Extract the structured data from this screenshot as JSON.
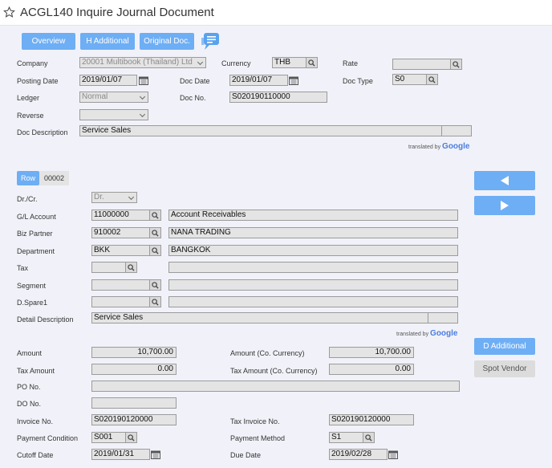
{
  "title": "ACGL140 Inquire Journal Document",
  "toolbar": {
    "overview": "Overview",
    "h_additional": "H Additional",
    "original_doc": "Original Doc."
  },
  "header": {
    "company_label": "Company",
    "company_value": "20001 Multibook (Thailand) Ltd",
    "currency_label": "Currency",
    "currency_value": "THB",
    "rate_label": "Rate",
    "rate_value": "",
    "posting_date_label": "Posting Date",
    "posting_date_value": "2019/01/07",
    "doc_date_label": "Doc Date",
    "doc_date_value": "2019/01/07",
    "doc_type_label": "Doc Type",
    "doc_type_value": "S0",
    "ledger_label": "Ledger",
    "ledger_value": "Normal",
    "doc_no_label": "Doc No.",
    "doc_no_value": "S020190110000",
    "reverse_label": "Reverse",
    "reverse_value": "",
    "doc_desc_label": "Doc Description",
    "doc_desc_value": "Service Sales"
  },
  "translated": {
    "prefix": "translated by",
    "brand": "Google"
  },
  "row": {
    "label": "Row",
    "value": "00002"
  },
  "detail": {
    "drcr_label": "Dr./Cr.",
    "drcr_value": "Dr.",
    "gl_label": "G/L Account",
    "gl_code": "11000000",
    "gl_name": "Account Receivables",
    "bp_label": "Biz Partner",
    "bp_code": "910002",
    "bp_name": "NANA TRADING",
    "dept_label": "Department",
    "dept_code": "BKK",
    "dept_name": "BANGKOK",
    "tax_label": "Tax",
    "segment_label": "Segment",
    "dspare_label": "D.Spare1",
    "detail_desc_label": "Detail Description",
    "detail_desc_value": "Service Sales"
  },
  "amounts": {
    "amount_label": "Amount",
    "amount_value": "10,700.00",
    "amount_cc_label": "Amount (Co. Currency)",
    "amount_cc_value": "10,700.00",
    "tax_amount_label": "Tax Amount",
    "tax_amount_value": "0.00",
    "tax_amount_cc_label": "Tax Amount (Co. Currency)",
    "tax_amount_cc_value": "0.00",
    "po_label": "PO No.",
    "do_label": "DO No.",
    "invoice_label": "Invoice No.",
    "invoice_value": "S020190120000",
    "tax_invoice_label": "Tax Invoice No.",
    "tax_invoice_value": "S020190120000",
    "pay_cond_label": "Payment Condition",
    "pay_cond_value": "S001",
    "pay_method_label": "Payment Method",
    "pay_method_value": "S1",
    "cutoff_label": "Cutoff Date",
    "cutoff_value": "2019/01/31",
    "due_label": "Due Date",
    "due_value": "2019/02/28"
  },
  "side": {
    "d_additional": "D Additional",
    "spot_vendor": "Spot Vendor"
  },
  "colors": {
    "accent": "#6eaef4",
    "field_bg": "#e4e4e4",
    "page_bg": "#f1f2f9"
  },
  "icons": [
    "star-icon",
    "chat-icon",
    "search-icon",
    "calendar-icon",
    "chevron-down-icon",
    "arrow-left-icon",
    "arrow-right-icon"
  ]
}
